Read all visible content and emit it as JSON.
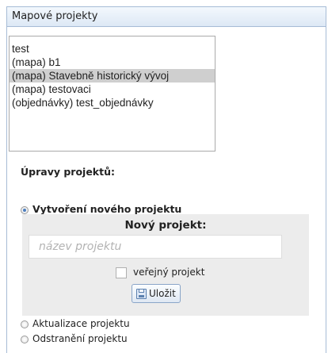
{
  "panel": {
    "title": "Mapové projekty"
  },
  "projects": {
    "items": [
      "test",
      "(mapa) b1",
      "(mapa) Stavebně historický vývoj",
      "(mapa) testovaci",
      "(objednávky) test_objednávky"
    ],
    "selected_index": 2
  },
  "edits": {
    "title": "Úpravy projektů:",
    "options": [
      {
        "label": "Vytvoření nového projektu",
        "checked": true
      },
      {
        "label": "Aktualizace projektu",
        "checked": false
      },
      {
        "label": "Odstranění projektu",
        "checked": false
      }
    ]
  },
  "new_project": {
    "title": "Nový projekt:",
    "name_placeholder": "název projektu",
    "name_value": "",
    "public_label": "veřejný projekt",
    "public_checked": false,
    "save_label": "Uložit"
  },
  "icons": {
    "save": "floppy-disk-icon"
  },
  "colors": {
    "header_border": "#a7bcd6",
    "selected_row": "#cfcfcf",
    "form_background": "#ececec",
    "radio_dot": "#4d7fbf"
  }
}
